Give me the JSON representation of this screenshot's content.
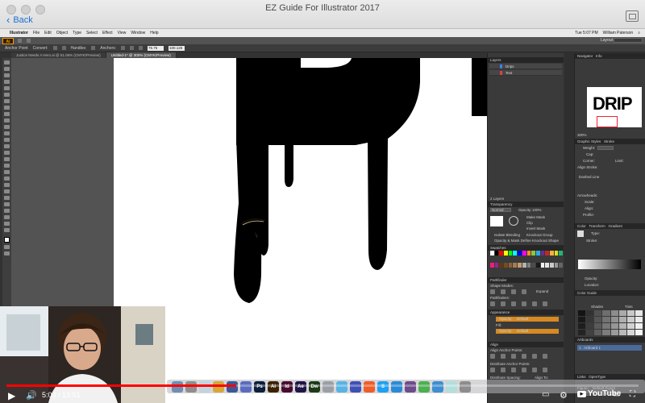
{
  "window": {
    "title": "EZ  Guide For Illustrator 2017",
    "back_label": "Back"
  },
  "menubar": {
    "app": "Illustrator",
    "items": [
      "File",
      "Edit",
      "Object",
      "Type",
      "Select",
      "Effect",
      "View",
      "Window",
      "Help"
    ],
    "clock": "Tue 5:07 PM",
    "user": "William Paterson"
  },
  "appbar": {
    "logo": "Ai",
    "workspace": "Layout"
  },
  "control_bar": {
    "anchor_point": "Anchor Point",
    "convert": "Convert:",
    "handles": "Handles:",
    "anchors": "Anchors:",
    "x_value": "75.75 mm",
    "y_value": "100.125 mm"
  },
  "doc_tabs": [
    {
      "label": "Justice Needs A Hero.ai @ 51.06% (CMYK/Preview)",
      "active": false
    },
    {
      "label": "Untitled-1* @ 300% (CMYK/Preview)",
      "active": true
    }
  ],
  "layers_panel": {
    "title": "Layers",
    "rows": [
      {
        "name": "Drips",
        "color": "#3f7fe0"
      },
      {
        "name": "Text",
        "color": "#e03f3f"
      }
    ],
    "footer": "2 Layers"
  },
  "transparency_panel": {
    "title": "Transparency",
    "mode": "Normal",
    "opacity_label": "Opacity:",
    "opacity": "100%",
    "make_mask": "Make Mask",
    "clip": "Clip",
    "invert_mask": "Invert Mask",
    "isolate_blending": "Isolate Blending",
    "knockout_group": "Knockout Group",
    "opacity_mask_note": "Opacity & Mask Define Knockout Shape"
  },
  "swatches_panel": {
    "title": "Swatches",
    "colors": [
      "#ffffff",
      "#000000",
      "#ff0000",
      "#ffff00",
      "#00ff00",
      "#00ffff",
      "#0000ff",
      "#ff00ff",
      "#f7931e",
      "#8cc63f",
      "#29abe2",
      "#662d91",
      "#c1272d",
      "#fbb03b",
      "#d9e021",
      "#22b573",
      "#ed1e79",
      "#93278f",
      "#603813",
      "#754c24",
      "#8c6239",
      "#a67c52",
      "#c69c6d",
      "#b3b3b3",
      "#808080",
      "#4d4d4d",
      "#1a1a1a",
      "#f2f2f2",
      "#e6e6e6",
      "#ccc",
      "#999",
      "#666"
    ]
  },
  "pathfinder_panel": {
    "title": "Pathfinder",
    "shape_modes": "Shape Modes:",
    "expand": "Expand",
    "pathfinders": "Pathfinders:"
  },
  "appearance_panel": {
    "title": "Appearance",
    "opacity_label": "Opacity:",
    "opacity_value": "Default",
    "fill_label": "Fill:"
  },
  "align_panel": {
    "title": "Align",
    "align_anchor": "Align Anchor Points:",
    "distribute_anchor": "Distribute Anchor Points:",
    "distribute_spacing": "Distribute Spacing:",
    "align_to": "Align To:"
  },
  "navigator_panel": {
    "tabs": [
      "Navigator",
      "Info"
    ],
    "thumb_text": "DRIP",
    "zoom": "300%"
  },
  "stroke_panel": {
    "tabs": [
      "Graphic Styles",
      "Stroke"
    ],
    "weight": "Weight:",
    "cap": "Cap:",
    "corner": "Corner:",
    "limit": "Limit:",
    "align_stroke": "Align Stroke:",
    "dashed_line": "Dashed Line",
    "arrowheads": "Arrowheads:",
    "scale": "Scale:",
    "align": "Align:",
    "profile": "Profile:"
  },
  "gradient_panel": {
    "tabs": [
      "Color",
      "Transform",
      "Gradient"
    ],
    "type_label": "Type:",
    "stroke_label": "Stroke:",
    "opacity_label": "Opacity:",
    "location_label": "Location:"
  },
  "color_guide_panel": {
    "title": "Color Guide",
    "shades": "Shades",
    "tints": "Tints"
  },
  "artboards_panel": {
    "title": "Artboards",
    "item_num": "1",
    "item_name": "Artboard 1"
  },
  "char_panel": {
    "tabs": [
      "Links",
      "OpenType"
    ],
    "figure": "Figure:",
    "figure_value": "Default Figure",
    "position": "Position:",
    "position_value": "Default Position"
  },
  "player": {
    "current_time": "5:03",
    "duration": "13:51",
    "progress": 0.364,
    "youtube_label": "YouTube"
  },
  "dock_apps": [
    {
      "label": "",
      "color": "#6d8fb5"
    },
    {
      "label": "",
      "color": "#8e8e8e"
    },
    {
      "label": "",
      "color": "#c0d3df"
    },
    {
      "label": "",
      "color": "#d4a83a"
    },
    {
      "label": "",
      "color": "#3b5998"
    },
    {
      "label": "",
      "color": "#5b6cc0"
    },
    {
      "label": "Ps",
      "color": "#0c1f3c"
    },
    {
      "label": "Ai",
      "color": "#3c2100"
    },
    {
      "label": "Id",
      "color": "#480a2e"
    },
    {
      "label": "Ae",
      "color": "#1f1547"
    },
    {
      "label": "Dw",
      "color": "#1d3a18"
    },
    {
      "label": "",
      "color": "#9aa0a6"
    },
    {
      "label": "",
      "color": "#57b4e3"
    },
    {
      "label": "",
      "color": "#3f51b5"
    },
    {
      "label": "",
      "color": "#ee5e2a"
    },
    {
      "label": "S",
      "color": "#1da1f2"
    },
    {
      "label": "",
      "color": "#2a8ad7"
    },
    {
      "label": "",
      "color": "#6e4b8b"
    },
    {
      "label": "",
      "color": "#4caf50"
    },
    {
      "label": "",
      "color": "#3d8fd1"
    },
    {
      "label": "",
      "color": "#b2dfdb"
    },
    {
      "label": "",
      "color": "#8d8d8d"
    }
  ]
}
